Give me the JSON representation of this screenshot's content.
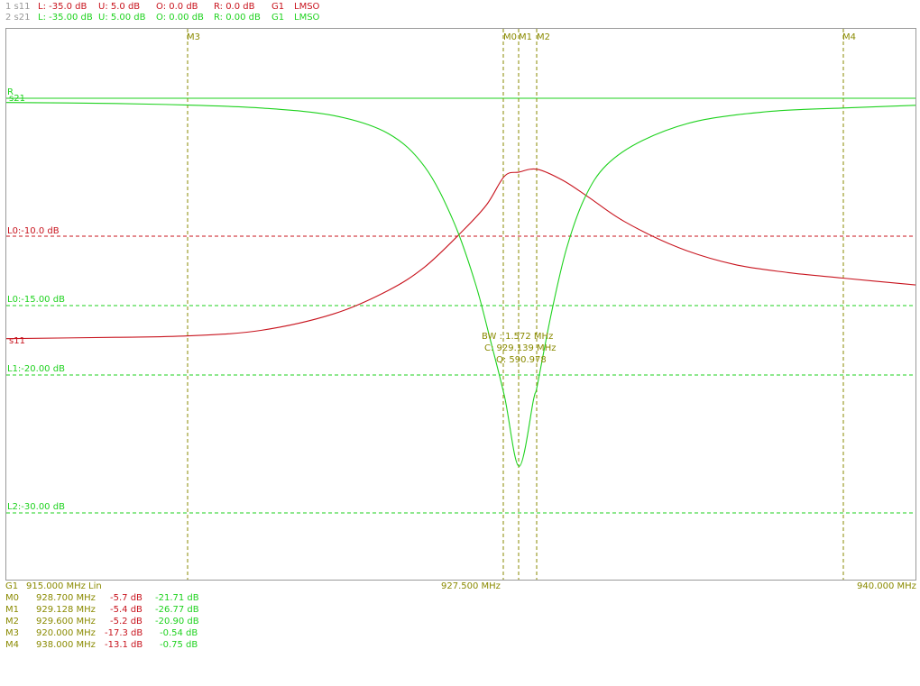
{
  "header": {
    "trace1": {
      "id": "1 s11",
      "L": "L: -35.0 dB",
      "U": "U:  5.0 dB",
      "O": "O:  0.0 dB",
      "R": "R:  0.0 dB",
      "G": "G1",
      "mode": "LMSO"
    },
    "trace2": {
      "id": "2 s21",
      "L": "L: -35.00 dB",
      "U": "U:  5.00 dB",
      "O": "O:  0.00 dB",
      "R": "R:  0.00 dB",
      "G": "G1",
      "mode": "LMSO"
    }
  },
  "plot": {
    "markers": [
      "M3",
      "M0",
      "M1",
      "M2",
      "M4"
    ],
    "lines": {
      "r": "R",
      "s21": "s21",
      "s11": "s11",
      "l0_s11": "L0:-10.0 dB",
      "l0_s21": "L0:-15.00 dB",
      "l1_s21": "L1:-20.00 dB",
      "l2_s21": "L2:-30.00 dB"
    },
    "bandwidth": {
      "bw": "BW : 1.572 MHz",
      "center": "C: 929.139 MHz",
      "q": "Q: 590.978"
    }
  },
  "footer": {
    "axis": {
      "group": "G1",
      "start": "915.000 MHz",
      "scale": "Lin",
      "center": "927.500 MHz",
      "stop": "940.000 MHz"
    },
    "markers": [
      {
        "name": "M0",
        "freq": "928.700 MHz",
        "s11": "-5.7 dB",
        "s21": "-21.71 dB"
      },
      {
        "name": "M1",
        "freq": "929.128 MHz",
        "s11": "-5.4 dB",
        "s21": "-26.77 dB"
      },
      {
        "name": "M2",
        "freq": "929.600 MHz",
        "s11": "-5.2 dB",
        "s21": "-20.90 dB"
      },
      {
        "name": "M3",
        "freq": "920.000 MHz",
        "s11": "-17.3 dB",
        "s21": "-0.54 dB"
      },
      {
        "name": "M4",
        "freq": "938.000 MHz",
        "s11": "-13.1 dB",
        "s21": "-0.75 dB"
      }
    ]
  },
  "colors": {
    "s11": "#c8141e",
    "s21": "#1ed21e",
    "marker": "#8a8a00",
    "frame": "#9a9a9a"
  },
  "chart_data": {
    "type": "line",
    "x_range_mhz": [
      915.0,
      940.0
    ],
    "y_range_db": [
      -35,
      5
    ],
    "series": [
      {
        "name": "s11",
        "x": [
          915,
          918,
          920,
          922,
          924,
          925.5,
          926.5,
          927.5,
          928.2,
          928.7,
          929.1,
          929.6,
          930.3,
          931,
          932,
          933.5,
          935,
          936.5,
          938,
          940
        ],
        "y": [
          -17.5,
          -17.4,
          -17.3,
          -16.9,
          -15.7,
          -14.0,
          -12.3,
          -9.8,
          -7.8,
          -5.7,
          -5.4,
          -5.2,
          -6.0,
          -7.2,
          -9.0,
          -10.9,
          -12.1,
          -12.7,
          -13.1,
          -13.6
        ]
      },
      {
        "name": "s21",
        "x": [
          915,
          918,
          920,
          922,
          924,
          925.5,
          926.5,
          927.3,
          927.9,
          928.3,
          928.7,
          929.1,
          929.5,
          929.6,
          930.0,
          930.4,
          930.9,
          931.5,
          932.5,
          934,
          936,
          938,
          940
        ],
        "y": [
          -0.35,
          -0.42,
          -0.54,
          -0.75,
          -1.3,
          -2.6,
          -5.0,
          -9.0,
          -13.5,
          -17.5,
          -21.71,
          -26.77,
          -21.9,
          -20.9,
          -15.5,
          -11.0,
          -7.3,
          -4.9,
          -3.1,
          -1.7,
          -1.0,
          -0.75,
          -0.55
        ]
      }
    ],
    "markers_mhz": {
      "M0": 928.7,
      "M1": 929.128,
      "M2": 929.6,
      "M3": 920.0,
      "M4": 938.0
    },
    "limit_lines_db": {
      "s11_L0": -10.0,
      "s21_L0": -15.0,
      "s21_L1": -20.0,
      "s21_L2": -30.0,
      "R": 0.0
    },
    "grid": false
  }
}
